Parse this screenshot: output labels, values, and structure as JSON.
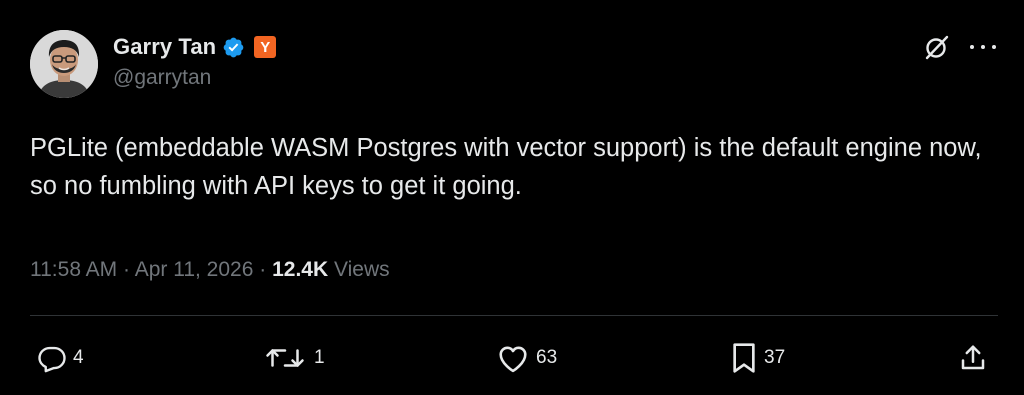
{
  "author": {
    "display_name": "Garry Tan",
    "handle": "@garrytan",
    "verified": true,
    "affiliate_badge": "Y",
    "affiliate_badge_color": "#f26522",
    "verified_color": "#1d9bf0"
  },
  "header_icons": {
    "grok": "grok-icon",
    "more": "more-icon"
  },
  "tweet": {
    "text": "PGLite (embeddable WASM Postgres with vector support) is the default engine now, so no fumbling with API keys to get it going."
  },
  "meta": {
    "time": "11:58 AM",
    "separator": "·",
    "date": "Apr 11, 2026",
    "views_count": "12.4K",
    "views_label": "Views"
  },
  "actions": {
    "replies": "4",
    "reposts": "1",
    "likes": "63",
    "bookmarks": "37"
  },
  "colors": {
    "background": "#000000",
    "text": "#e7e9ea",
    "secondary": "#71767b",
    "divider": "#2f3336"
  }
}
